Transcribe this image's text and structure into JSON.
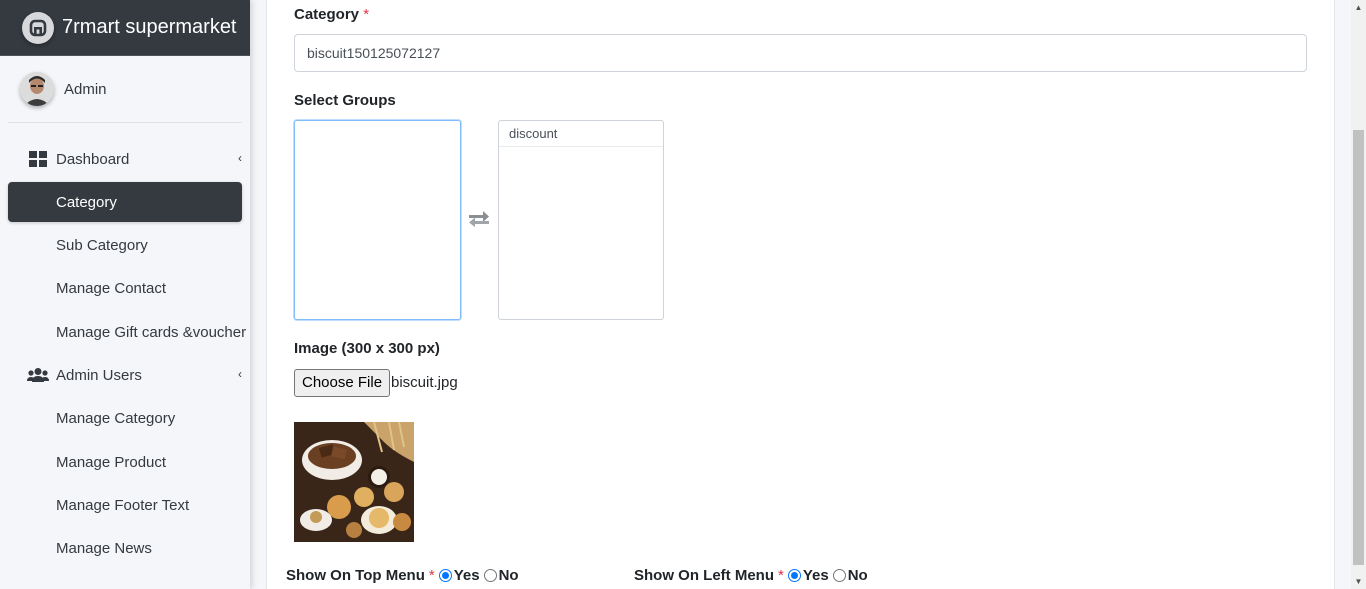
{
  "app": {
    "brand": "7rmart supermarket",
    "user": "Admin"
  },
  "sidebar": {
    "items": [
      {
        "label": "Dashboard",
        "icon": "dashboard-icon"
      },
      {
        "label": "Category"
      },
      {
        "label": "Sub Category"
      },
      {
        "label": "Manage Contact"
      },
      {
        "label": "Manage Gift cards &voucher"
      },
      {
        "label": "Admin Users",
        "icon": "users-icon"
      },
      {
        "label": "Manage Category"
      },
      {
        "label": "Manage Product"
      },
      {
        "label": "Manage Footer Text"
      },
      {
        "label": "Manage News"
      }
    ]
  },
  "form": {
    "category_label": "Category",
    "required_mark": "*",
    "category_value": "biscuit150125072127",
    "groups_label": "Select Groups",
    "selected_options": [
      "discount"
    ],
    "image_label": "Image (300 x 300 px)",
    "choose_file": "Choose File",
    "file_name": "biscuit.jpg",
    "top_menu_label": "Show On Top Menu",
    "left_menu_label": "Show On Left Menu",
    "yes": "Yes",
    "no": "No",
    "top_menu_value": "Yes",
    "left_menu_value": "Yes"
  },
  "colors": {
    "sidebar_active": "#343a40",
    "brand_bg": "#343a40",
    "required": "#dc3545",
    "radio": "#0075ff"
  }
}
